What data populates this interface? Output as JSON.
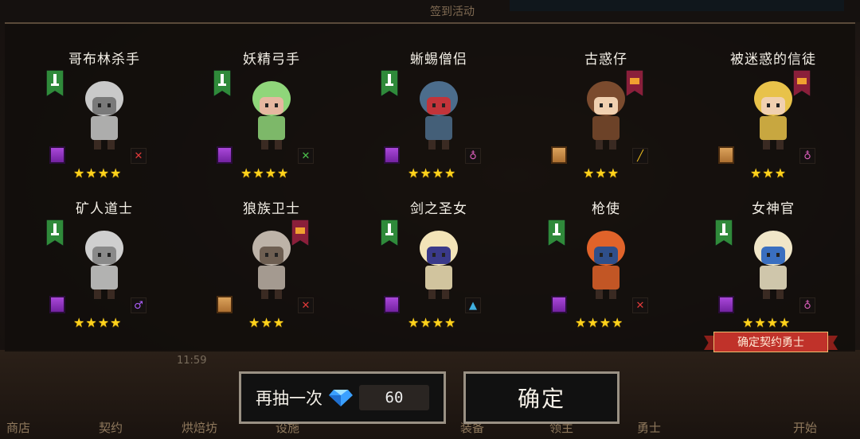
{
  "background": {
    "event_title": "签到活动",
    "time": "11:59",
    "nav": [
      "商店",
      "契约",
      "烘焙坊",
      "设施",
      "装备",
      "领主",
      "勇士",
      "开始"
    ]
  },
  "heroes": [
    {
      "name": "哥布林杀手",
      "class": "knight",
      "rarity": "purple",
      "stars": "★★★★",
      "weapon": "sword"
    },
    {
      "name": "妖精弓手",
      "class": "knight",
      "rarity": "purple",
      "stars": "★★★★",
      "weapon": "bow"
    },
    {
      "name": "蜥蜴僧侣",
      "class": "knight",
      "rarity": "purple",
      "stars": "★★★★",
      "weapon": "staff"
    },
    {
      "name": "古惑仔",
      "class": "support",
      "rarity": "tan",
      "stars": "★★★",
      "weapon": "knife"
    },
    {
      "name": "被迷惑的信徒",
      "class": "support",
      "rarity": "tan",
      "stars": "★★★",
      "weapon": "staff"
    },
    {
      "name": "矿人道士",
      "class": "knight",
      "rarity": "purple",
      "stars": "★★★★",
      "weapon": "wand"
    },
    {
      "name": "狼族卫士",
      "class": "support",
      "rarity": "tan",
      "stars": "★★★",
      "weapon": "sword"
    },
    {
      "name": "剑之圣女",
      "class": "knight",
      "rarity": "purple",
      "stars": "★★★★",
      "weapon": "hammer"
    },
    {
      "name": "枪使",
      "class": "knight",
      "rarity": "purple",
      "stars": "★★★★",
      "weapon": "sword"
    },
    {
      "name": "女神官",
      "class": "knight",
      "rarity": "purple",
      "stars": "★★★★",
      "weapon": "staff"
    }
  ],
  "actions": {
    "redraw_label": "再抽一次",
    "redraw_cost": "60",
    "confirm_label": "确定"
  },
  "contract_ribbon": "确定契约勇士",
  "colors": {
    "star": "#ffd21c",
    "knight_banner": "#2f8a3a",
    "support_banner": "#8a1f3a",
    "ribbon": "#c0322a"
  }
}
